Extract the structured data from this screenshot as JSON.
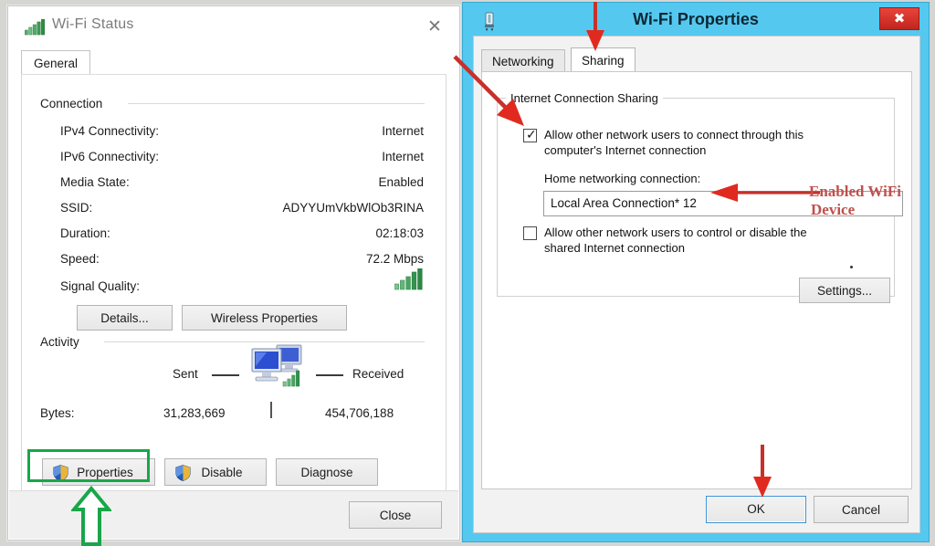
{
  "status_window": {
    "title": "Wi-Fi Status",
    "title_icon": "wifi-signal-bars-icon",
    "close_glyph": "✕",
    "tabs": [
      {
        "label": "General",
        "selected": true
      }
    ],
    "connection": {
      "group_label": "Connection",
      "rows": [
        {
          "key": "IPv4 Connectivity:",
          "value": "Internet"
        },
        {
          "key": "IPv6 Connectivity:",
          "value": "Internet"
        },
        {
          "key": "Media State:",
          "value": "Enabled"
        },
        {
          "key": "SSID:",
          "value": "ADYYUmVkbWlOb3RINA"
        },
        {
          "key": "Duration:",
          "value": "02:18:03"
        },
        {
          "key": "Speed:",
          "value": "72.2 Mbps"
        },
        {
          "key": "Signal Quality:",
          "value": ""
        }
      ],
      "signal_quality_icon": "signal-bars-icon",
      "buttons": [
        {
          "label": "Details..."
        },
        {
          "label": "Wireless Properties"
        }
      ]
    },
    "activity": {
      "group_label": "Activity",
      "sent_label": "Sent",
      "received_label": "Received",
      "center_icon": "two-computers-icon",
      "bytes_label": "Bytes:",
      "bytes_sent": "31,283,669",
      "bytes_received": "454,706,188"
    },
    "action_buttons": [
      {
        "label": "Properties",
        "icon": "uac-shield-icon",
        "highlighted": true
      },
      {
        "label": "Disable",
        "icon": "uac-shield-icon",
        "highlighted": false
      },
      {
        "label": "Diagnose",
        "icon": "",
        "highlighted": false
      }
    ],
    "footer_button": {
      "label": "Close"
    }
  },
  "properties_window": {
    "title": "Wi-Fi Properties",
    "title_icon": "network-adapter-icon",
    "close_glyph": "✖",
    "tabs": [
      {
        "label": "Networking",
        "selected": false
      },
      {
        "label": "Sharing",
        "selected": true
      }
    ],
    "sharing": {
      "group_label": "Internet Connection Sharing",
      "allow_connect": {
        "checked": true,
        "line1": "Allow other network users to connect through this",
        "line2": "computer's Internet connection"
      },
      "home_network_label": "Home networking connection:",
      "home_network_value": "Local Area Connection* 12",
      "allow_control": {
        "checked": false,
        "line1": "Allow other network users to control or disable the",
        "line2": "shared Internet connection"
      },
      "settings_button": {
        "label": "Settings..."
      }
    },
    "footer_buttons": [
      {
        "label": "OK",
        "focused": true
      },
      {
        "label": "Cancel",
        "focused": false
      }
    ]
  },
  "annotations": {
    "red_text_line1": "Enabled WiFi",
    "red_text_line2": "Device",
    "red_color": "#c0504d",
    "green_color": "#19a64a",
    "arrow_sharing_tab": "red-down-arrow-icon",
    "arrow_checkbox": "red-diagonal-arrow-icon",
    "arrow_combo": "red-left-arrow-icon",
    "arrow_ok": "red-down-arrow-icon",
    "arrow_properties": "green-up-arrow-icon",
    "highlight_properties": "green-rectangle-highlight"
  }
}
